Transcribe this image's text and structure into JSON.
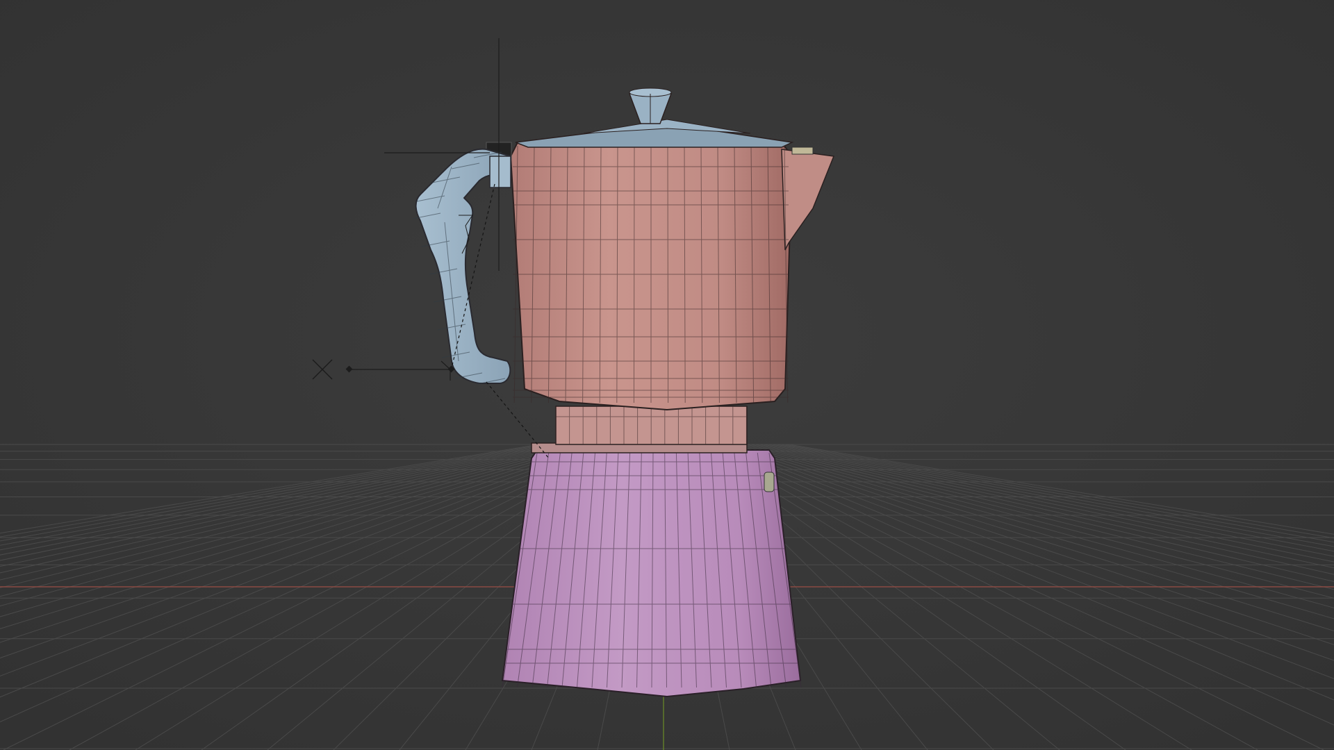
{
  "viewport": {
    "background_color": "#393939",
    "grid_color": "#4a4a4a",
    "x_axis_color": "#9a4b43",
    "y_axis_color": "#6b8a2c"
  },
  "model": {
    "upper_chamber_color": "#c48b83",
    "upper_chamber_shadow": "#a46c66",
    "collar_color": "#c08e88",
    "lower_chamber_color": "#bb8fbd",
    "lower_chamber_shadow": "#9a6f9d",
    "handle_color": "#9eb5c7",
    "lid_color": "#8ea6b8",
    "knob_color": "#9ab2c4",
    "wire_color": "#2a2020"
  },
  "gizmos": {
    "cursor_color": "#1c1c1c",
    "relationship_line_color": "#141414"
  }
}
